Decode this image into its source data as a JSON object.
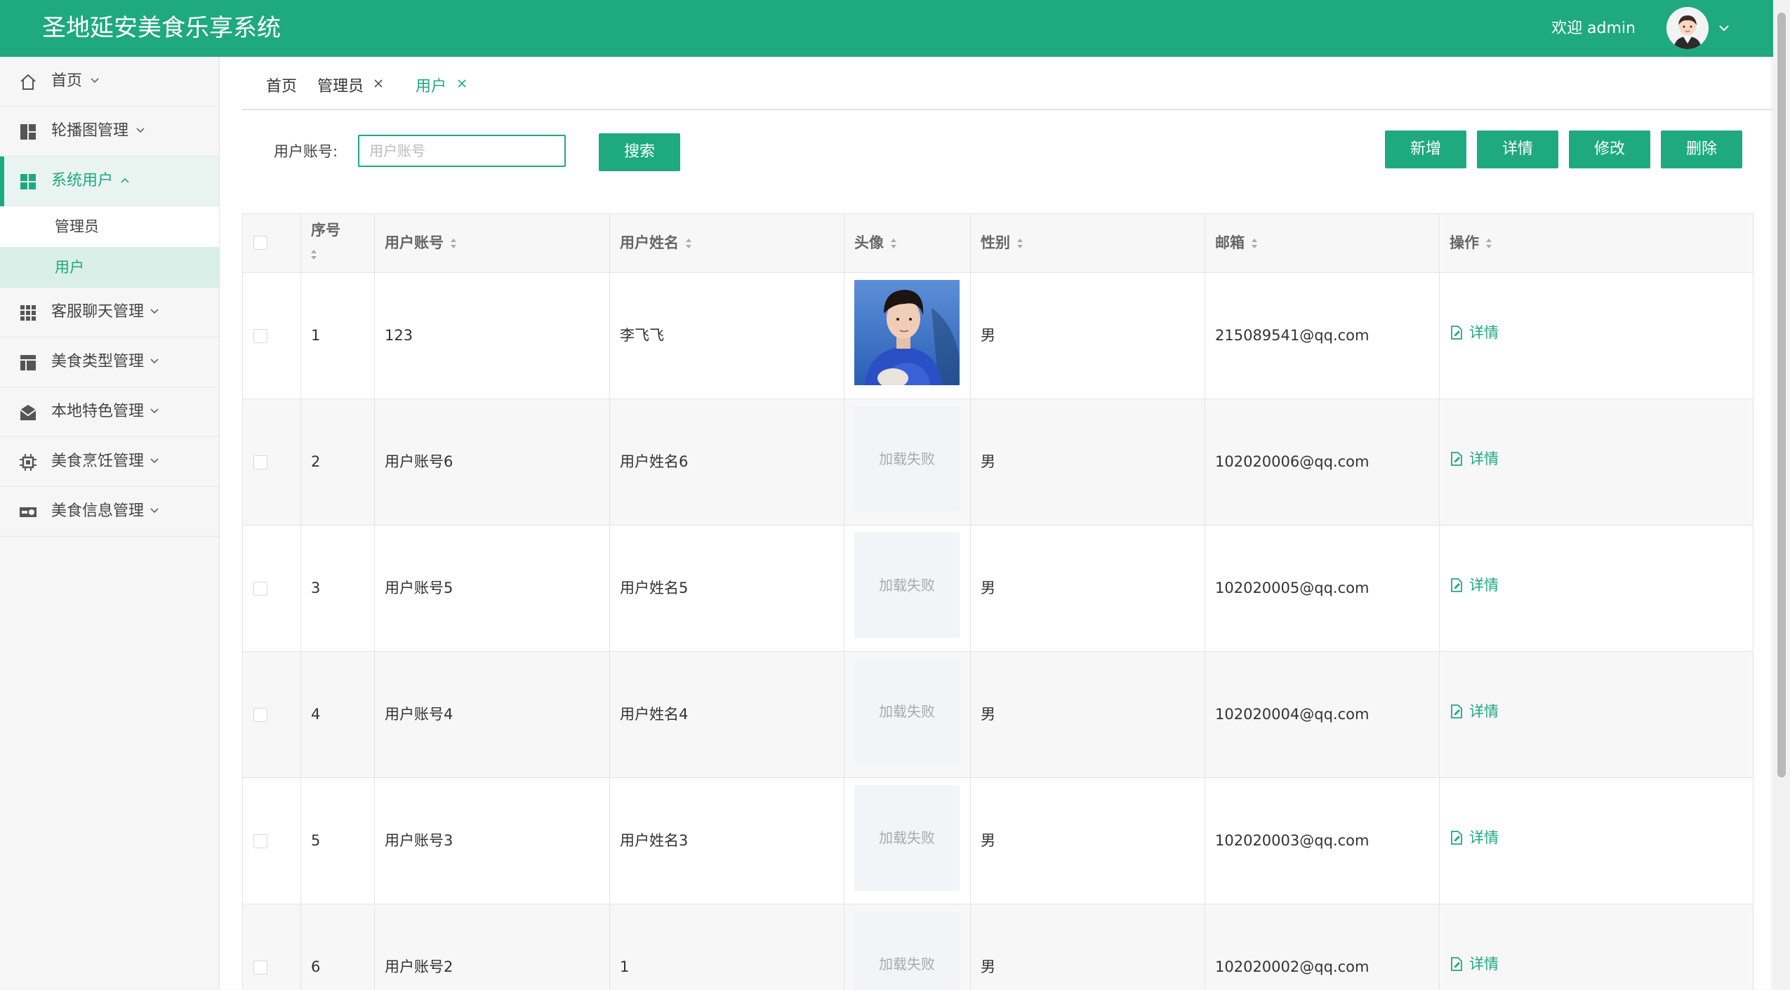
{
  "app": {
    "title": "圣地延安美食乐享系统",
    "welcome": "欢迎 admin",
    "accent_color": "#1fa97e"
  },
  "sidebar": {
    "items": [
      {
        "label": "首页",
        "icon": "home-icon"
      },
      {
        "label": "轮播图管理",
        "icon": "layout-icon"
      },
      {
        "label": "系统用户",
        "icon": "grid-icon",
        "expanded": true
      },
      {
        "label": "客服聊天管理",
        "icon": "apps-icon"
      },
      {
        "label": "美食类型管理",
        "icon": "table-icon"
      },
      {
        "label": "本地特色管理",
        "icon": "mail-icon"
      },
      {
        "label": "美食烹饪管理",
        "icon": "chip-icon"
      },
      {
        "label": "美食信息管理",
        "icon": "toggle-icon"
      }
    ],
    "subitems": [
      {
        "label": "管理员"
      },
      {
        "label": "用户",
        "selected": true
      }
    ]
  },
  "tabs": [
    {
      "label": "首页",
      "closable": false
    },
    {
      "label": "管理员",
      "closable": true
    },
    {
      "label": "用户",
      "closable": true,
      "active": true
    }
  ],
  "search": {
    "label": "用户账号:",
    "placeholder": "用户账号",
    "value": "",
    "button_label": "搜索"
  },
  "actions": {
    "add": "新增",
    "detail": "详情",
    "edit": "修改",
    "delete": "删除"
  },
  "table": {
    "columns": [
      "序号",
      "用户账号",
      "用户姓名",
      "头像",
      "性别",
      "邮箱",
      "操作"
    ],
    "image_fail_text": "加载失败",
    "op_label": "详情",
    "rows": [
      {
        "index": "1",
        "account": "123",
        "name": "李飞飞",
        "avatar": "photo",
        "gender": "男",
        "email": "215089541@qq.com"
      },
      {
        "index": "2",
        "account": "用户账号6",
        "name": "用户姓名6",
        "avatar": "failed",
        "gender": "男",
        "email": "102020006@qq.com"
      },
      {
        "index": "3",
        "account": "用户账号5",
        "name": "用户姓名5",
        "avatar": "failed",
        "gender": "男",
        "email": "102020005@qq.com"
      },
      {
        "index": "4",
        "account": "用户账号4",
        "name": "用户姓名4",
        "avatar": "failed",
        "gender": "男",
        "email": "102020004@qq.com"
      },
      {
        "index": "5",
        "account": "用户账号3",
        "name": "用户姓名3",
        "avatar": "failed",
        "gender": "男",
        "email": "102020003@qq.com"
      },
      {
        "index": "6",
        "account": "用户账号2",
        "name": "1",
        "avatar": "failed",
        "gender": "男",
        "email": "102020002@qq.com"
      }
    ]
  }
}
